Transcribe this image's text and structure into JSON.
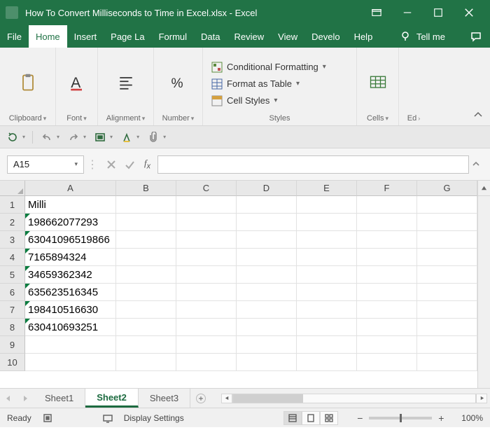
{
  "title": "How To Convert Milliseconds to Time in Excel.xlsx  -  Excel",
  "menu": {
    "tabs": [
      "File",
      "Home",
      "Insert",
      "Page La",
      "Formul",
      "Data",
      "Review",
      "View",
      "Develo",
      "Help"
    ],
    "active": "Home",
    "tellme": "Tell me"
  },
  "ribbon": {
    "clipboard": "Clipboard",
    "font": "Font",
    "alignment": "Alignment",
    "number": "Number",
    "styles": "Styles",
    "cells": "Cells",
    "editing": "Ed",
    "styleItems": {
      "cond": "Conditional Formatting",
      "table": "Format as Table",
      "cellstyles": "Cell Styles"
    }
  },
  "namebox": "A15",
  "columns": [
    "A",
    "B",
    "C",
    "D",
    "E",
    "F",
    "G"
  ],
  "rowNums": [
    "1",
    "2",
    "3",
    "4",
    "5",
    "6",
    "7",
    "8",
    "9",
    "10"
  ],
  "cellsA": {
    "1": "Milli",
    "2": "198662077293",
    "3": "63041096519866",
    "4": "7165894324",
    "5": "34659362342",
    "6": "635623516345",
    "7": "198410516630",
    "8": "630410693251"
  },
  "triangleRows": [
    "2",
    "3",
    "4",
    "5",
    "6",
    "7",
    "8"
  ],
  "sheets": {
    "list": [
      "Sheet1",
      "Sheet2",
      "Sheet3"
    ],
    "active": "Sheet2"
  },
  "status": {
    "ready": "Ready",
    "display": "Display Settings",
    "zoom": "100%"
  }
}
